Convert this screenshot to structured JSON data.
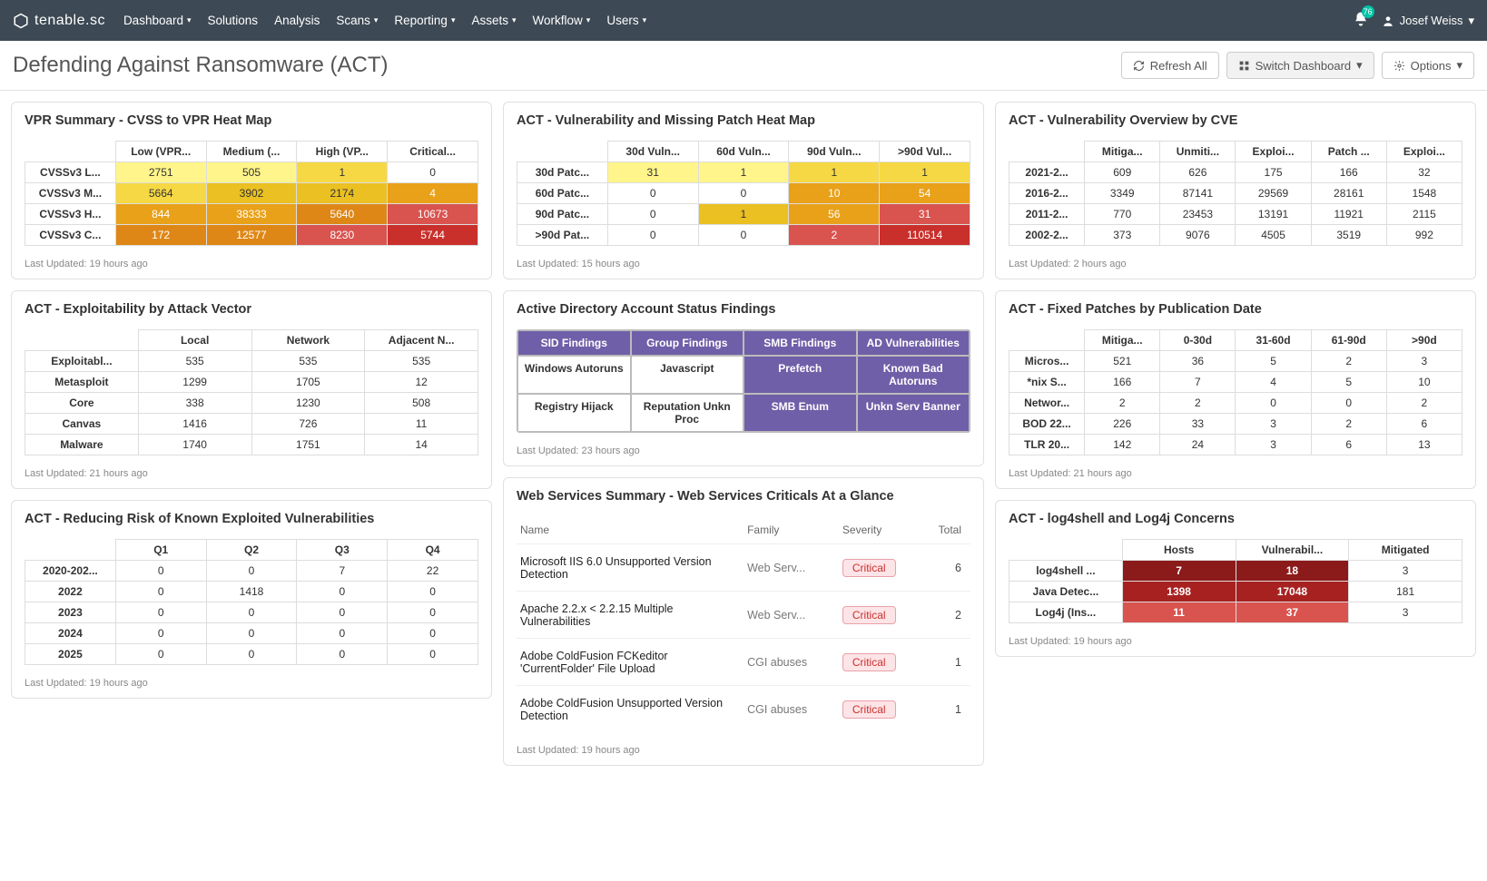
{
  "brand": "tenable.sc",
  "nav": [
    "Dashboard",
    "Solutions",
    "Analysis",
    "Scans",
    "Reporting",
    "Assets",
    "Workflow",
    "Users"
  ],
  "nav_has_caret": [
    true,
    false,
    false,
    true,
    true,
    true,
    true,
    true
  ],
  "notif_badge": "76",
  "user": "Josef Weiss",
  "page_title": "Defending Against Ransomware (ACT)",
  "actions": {
    "refresh": "Refresh All",
    "switch": "Switch Dashboard",
    "options": "Options"
  },
  "cards": {
    "vpr": {
      "title": "VPR Summary - CVSS to VPR Heat Map",
      "cols": [
        "Low (VPR...",
        "Medium (...",
        "High (VP...",
        "Critical..."
      ],
      "rows": [
        "CVSSv3 L...",
        "CVSSv3 M...",
        "CVSSv3 H...",
        "CVSSv3 C..."
      ],
      "data": [
        [
          "2751",
          "505",
          "1",
          "0"
        ],
        [
          "5664",
          "3902",
          "2174",
          "4"
        ],
        [
          "844",
          "38333",
          "5640",
          "10673"
        ],
        [
          "172",
          "12577",
          "8230",
          "5744"
        ]
      ],
      "classes": [
        [
          "hm-y1",
          "hm-y1",
          "hm-y2",
          ""
        ],
        [
          "hm-y2",
          "hm-y3",
          "hm-y3",
          "hm-o1"
        ],
        [
          "hm-o1",
          "hm-o1",
          "hm-o2",
          "hm-r1"
        ],
        [
          "hm-o2",
          "hm-o2",
          "hm-r1",
          "hm-r2"
        ]
      ],
      "updated": "Last Updated: 19 hours ago"
    },
    "patchheat": {
      "title": "ACT - Vulnerability and Missing Patch Heat Map",
      "cols": [
        "30d Vuln...",
        "60d Vuln...",
        "90d Vuln...",
        ">90d Vul..."
      ],
      "rows": [
        "30d Patc...",
        "60d Patc...",
        "90d Patc...",
        ">90d Pat..."
      ],
      "data": [
        [
          "31",
          "1",
          "1",
          "1"
        ],
        [
          "0",
          "0",
          "10",
          "54"
        ],
        [
          "0",
          "1",
          "56",
          "31"
        ],
        [
          "0",
          "0",
          "2",
          "110514"
        ]
      ],
      "classes": [
        [
          "hm-y1",
          "hm-y1",
          "hm-y2",
          "hm-y2"
        ],
        [
          "",
          "",
          "hm-o1",
          "hm-o1"
        ],
        [
          "",
          "hm-y3",
          "hm-o1",
          "hm-r1"
        ],
        [
          "",
          "",
          "hm-r1",
          "hm-r2"
        ]
      ],
      "updated": "Last Updated: 15 hours ago"
    },
    "cveoverview": {
      "title": "ACT - Vulnerability Overview by CVE",
      "cols": [
        "Mitiga...",
        "Unmiti...",
        "Exploi...",
        "Patch ...",
        "Exploi..."
      ],
      "rows": [
        "2021-2...",
        "2016-2...",
        "2011-2...",
        "2002-2..."
      ],
      "data": [
        [
          "609",
          "626",
          "175",
          "166",
          "32"
        ],
        [
          "3349",
          "87141",
          "29569",
          "28161",
          "1548"
        ],
        [
          "770",
          "23453",
          "13191",
          "11921",
          "2115"
        ],
        [
          "373",
          "9076",
          "4505",
          "3519",
          "992"
        ]
      ],
      "updated": "Last Updated: 2 hours ago"
    },
    "exploitvector": {
      "title": "ACT - Exploitability by Attack Vector",
      "cols": [
        "Local",
        "Network",
        "Adjacent N..."
      ],
      "rows": [
        "Exploitabl...",
        "Metasploit",
        "Core",
        "Canvas",
        "Malware"
      ],
      "data": [
        [
          "535",
          "535",
          "535"
        ],
        [
          "1299",
          "1705",
          "12"
        ],
        [
          "338",
          "1230",
          "508"
        ],
        [
          "1416",
          "726",
          "11"
        ],
        [
          "1740",
          "1751",
          "14"
        ]
      ],
      "updated": "Last Updated: 21 hours ago"
    },
    "adstatus": {
      "title": "Active Directory Account Status Findings",
      "cells": [
        "SID Findings",
        "Group Findings",
        "SMB Findings",
        "AD Vulnerabilities",
        "Windows Autoruns",
        "Javascript",
        "Prefetch",
        "Known Bad Autoruns",
        "Registry Hijack",
        "Reputation Unkn Proc",
        "SMB Enum",
        "Unkn Serv Banner"
      ],
      "cell_classes": [
        "ad-purple",
        "ad-purple",
        "ad-purple",
        "ad-purple",
        "ad-white",
        "ad-white",
        "ad-purple",
        "ad-purple",
        "ad-white",
        "ad-white",
        "ad-purple",
        "ad-purple"
      ],
      "updated": "Last Updated: 23 hours ago"
    },
    "websvc": {
      "title": "Web Services Summary - Web Services Criticals At a Glance",
      "head": [
        "Name",
        "Family",
        "Severity",
        "Total"
      ],
      "rows": [
        {
          "name": "Microsoft IIS 6.0 Unsupported Version Detection",
          "family": "Web Serv...",
          "sev": "Critical",
          "total": "6"
        },
        {
          "name": "Apache 2.2.x < 2.2.15 Multiple Vulnerabilities",
          "family": "Web Serv...",
          "sev": "Critical",
          "total": "2"
        },
        {
          "name": "Adobe ColdFusion FCKeditor 'CurrentFolder' File Upload",
          "family": "CGI abuses",
          "sev": "Critical",
          "total": "1"
        },
        {
          "name": "Adobe ColdFusion Unsupported Version Detection",
          "family": "CGI abuses",
          "sev": "Critical",
          "total": "1"
        }
      ],
      "updated": "Last Updated: 19 hours ago"
    },
    "fixedpatches": {
      "title": "ACT - Fixed Patches by Publication Date",
      "cols": [
        "Mitiga...",
        "0-30d",
        "31-60d",
        "61-90d",
        ">90d"
      ],
      "rows": [
        "Micros...",
        "*nix S...",
        "Networ...",
        "BOD 22...",
        "TLR 20..."
      ],
      "data": [
        [
          "521",
          "36",
          "5",
          "2",
          "3"
        ],
        [
          "166",
          "7",
          "4",
          "5",
          "10"
        ],
        [
          "2",
          "2",
          "0",
          "0",
          "2"
        ],
        [
          "226",
          "33",
          "3",
          "2",
          "6"
        ],
        [
          "142",
          "24",
          "3",
          "6",
          "13"
        ]
      ],
      "updated": "Last Updated: 21 hours ago"
    },
    "reducing": {
      "title": "ACT - Reducing Risk of Known Exploited Vulnerabilities",
      "cols": [
        "Q1",
        "Q2",
        "Q3",
        "Q4"
      ],
      "rows": [
        "2020-202...",
        "2022",
        "2023",
        "2024",
        "2025"
      ],
      "data": [
        [
          "0",
          "0",
          "7",
          "22"
        ],
        [
          "0",
          "1418",
          "0",
          "0"
        ],
        [
          "0",
          "0",
          "0",
          "0"
        ],
        [
          "0",
          "0",
          "0",
          "0"
        ],
        [
          "0",
          "0",
          "0",
          "0"
        ]
      ],
      "updated": "Last Updated: 19 hours ago"
    },
    "log4": {
      "title": "ACT - log4shell and Log4j Concerns",
      "cols": [
        "Hosts",
        "Vulnerabil...",
        "Mitigated"
      ],
      "rows": [
        "log4shell ...",
        "Java Detec...",
        "Log4j (Ins..."
      ],
      "data": [
        [
          "7",
          "18",
          "3"
        ],
        [
          "1398",
          "17048",
          "181"
        ],
        [
          "11",
          "37",
          "3"
        ]
      ],
      "classes": [
        [
          "l1",
          "l1",
          ""
        ],
        [
          "l2",
          "l2",
          ""
        ],
        [
          "l3",
          "l3",
          ""
        ]
      ],
      "updated": "Last Updated: 19 hours ago"
    }
  }
}
